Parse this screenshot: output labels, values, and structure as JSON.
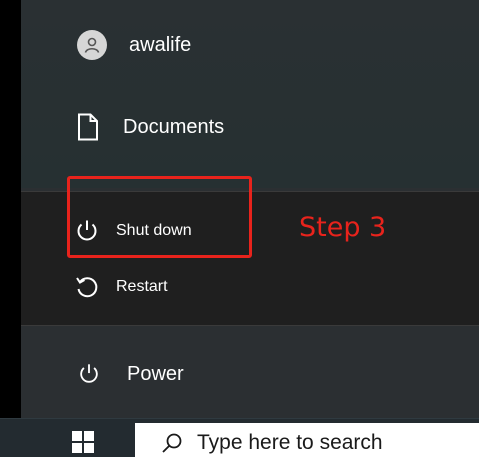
{
  "start_menu": {
    "user": {
      "name": "awalife",
      "icon": "user-avatar-icon"
    },
    "documents": {
      "label": "Documents",
      "icon": "document-icon"
    },
    "power": {
      "label": "Power",
      "icon": "power-icon"
    }
  },
  "power_flyout": {
    "items": [
      {
        "label": "Shut down",
        "icon": "power-icon"
      },
      {
        "label": "Restart",
        "icon": "restart-icon"
      }
    ]
  },
  "annotation": {
    "step_label": "Step 3",
    "color": "#e8231c"
  },
  "taskbar": {
    "start_icon": "windows-logo-icon",
    "search": {
      "placeholder": "Type here to search",
      "icon": "search-icon"
    }
  },
  "colors": {
    "menu_bg": "#2b2f32",
    "flyout_bg": "#1f1f1f",
    "taskbar_bg": "#232b30",
    "text": "#ffffff"
  }
}
